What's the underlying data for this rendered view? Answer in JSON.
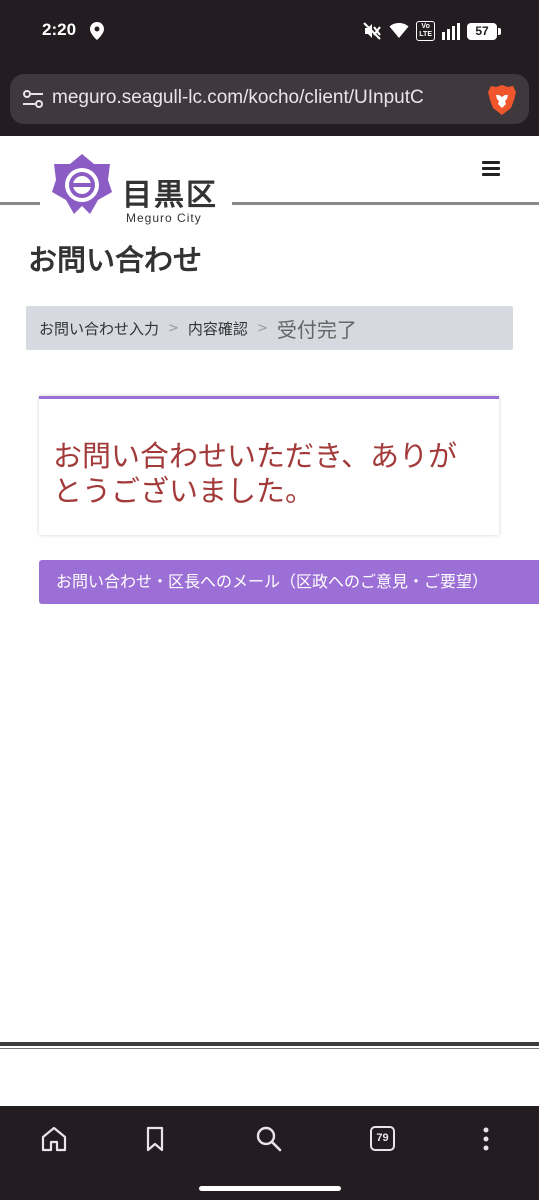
{
  "status_bar": {
    "time": "2:20",
    "volte_label": "Vo\nLTE",
    "battery_level": "57"
  },
  "browser": {
    "url": "meguro.seagull-lc.com/kocho/client/UInputC",
    "tab_count": "79"
  },
  "site": {
    "logo_kanji": "目黒区",
    "logo_en": "Meguro City",
    "brand_color": "#9c6fd6"
  },
  "page": {
    "title": "お問い合わせ",
    "breadcrumb": [
      "お問い合わせ入力",
      "内容確認",
      "受付完了"
    ],
    "breadcrumb_separator": ">",
    "thanks_message": "お問い合わせいただき、ありがとうございました。",
    "thanks_color": "#a33a3a",
    "mail_link_label": "お問い合わせ・区長へのメール（区政へのご意見・ご要望）"
  },
  "icons": {
    "status": [
      "location-icon",
      "mute-icon",
      "wifi-icon",
      "signal-icon",
      "battery-icon"
    ],
    "browser": [
      "site-settings-icon",
      "brave-lion-icon"
    ],
    "toolbar": [
      "home-icon",
      "bookmark-icon",
      "search-icon",
      "tabs-icon",
      "more-icon"
    ]
  }
}
